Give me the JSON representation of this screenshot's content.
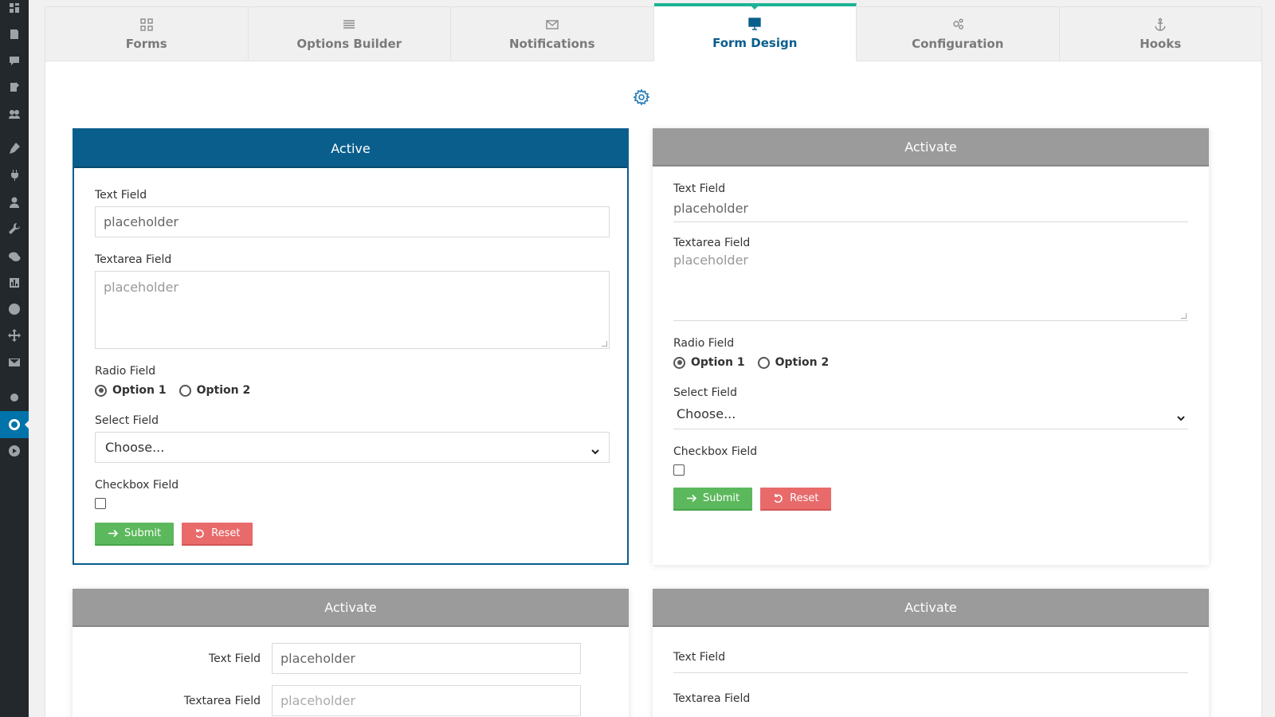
{
  "wp_sidebar": {
    "icons": [
      "dashboard-icon",
      "posts-icon",
      "comments-icon",
      "pages-icon",
      "groups-icon",
      "appearance-icon",
      "plugins-icon",
      "users-icon",
      "tools-icon",
      "chat-icon",
      "stats-icon",
      "support-icon",
      "move-icon",
      "mail-icon",
      "settings-icon",
      "circle-plugin-icon",
      "play-icon"
    ]
  },
  "tabs": [
    {
      "label": "Forms",
      "icon": "grid-icon"
    },
    {
      "label": "Options Builder",
      "icon": "list-icon"
    },
    {
      "label": "Notifications",
      "icon": "envelope-icon"
    },
    {
      "label": "Form Design",
      "icon": "monitor-icon",
      "active": true
    },
    {
      "label": "Configuration",
      "icon": "gears-icon"
    },
    {
      "label": "Hooks",
      "icon": "anchor-icon"
    }
  ],
  "colors": {
    "accent": "#0a5e8c",
    "tab_indicator": "#1db394",
    "inactive_header": "#9b9b9b",
    "submit": "#5cb85c",
    "reset": "#e86a6a"
  },
  "cards": {
    "c1": {
      "header": "Active",
      "text_label": "Text Field",
      "text_value": "placeholder",
      "textarea_label": "Textarea Field",
      "textarea_value": "placeholder",
      "radio_label": "Radio Field",
      "option1": "Option 1",
      "option2": "Option 2",
      "select_label": "Select Field",
      "select_value": "Choose...",
      "checkbox_label": "Checkbox Field",
      "submit": "Submit",
      "reset": "Reset"
    },
    "c2": {
      "header": "Activate",
      "text_label": "Text Field",
      "text_value": "placeholder",
      "textarea_label": "Textarea Field",
      "textarea_value": "placeholder",
      "radio_label": "Radio Field",
      "option1": "Option 1",
      "option2": "Option 2",
      "select_label": "Select Field",
      "select_value": "Choose...",
      "checkbox_label": "Checkbox Field",
      "submit": "Submit",
      "reset": "Reset"
    },
    "c3": {
      "header": "Activate",
      "text_label": "Text Field",
      "text_value": "placeholder",
      "textarea_label": "Textarea Field",
      "textarea_value": "placeholder"
    },
    "c4": {
      "header": "Activate",
      "text_label": "Text Field",
      "textarea_label": "Textarea Field"
    }
  }
}
